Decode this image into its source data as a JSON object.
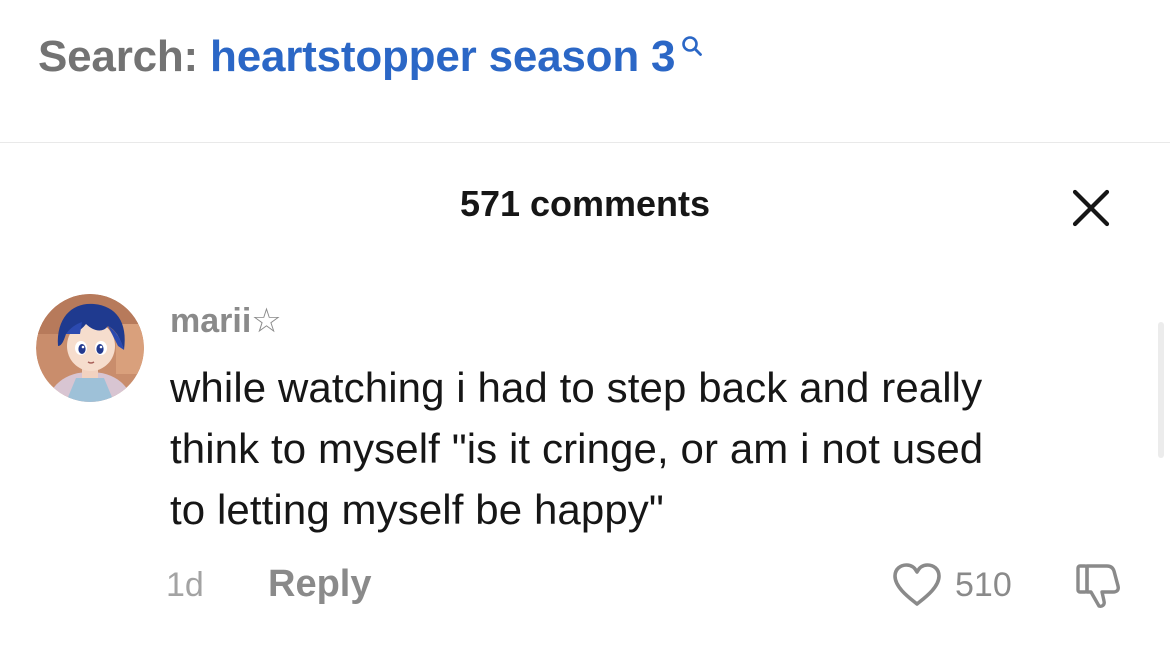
{
  "search": {
    "label": "Search:",
    "query": "heartstopper season 3",
    "icon": "search-icon",
    "query_color": "#2b67c6"
  },
  "comments_panel": {
    "title": "571 comments",
    "close_icon": "close-icon"
  },
  "comment": {
    "username": "marii☆",
    "avatar_icon": "user-avatar",
    "text_lines": [
      "while watching i had to step back and really",
      "think to myself \"is it cringe, or am i not used",
      "to letting myself be happy\""
    ],
    "timestamp": "1d",
    "reply_label": "Reply",
    "like_count": "510",
    "like_icon": "heart-icon",
    "dislike_icon": "thumbs-down-icon"
  }
}
